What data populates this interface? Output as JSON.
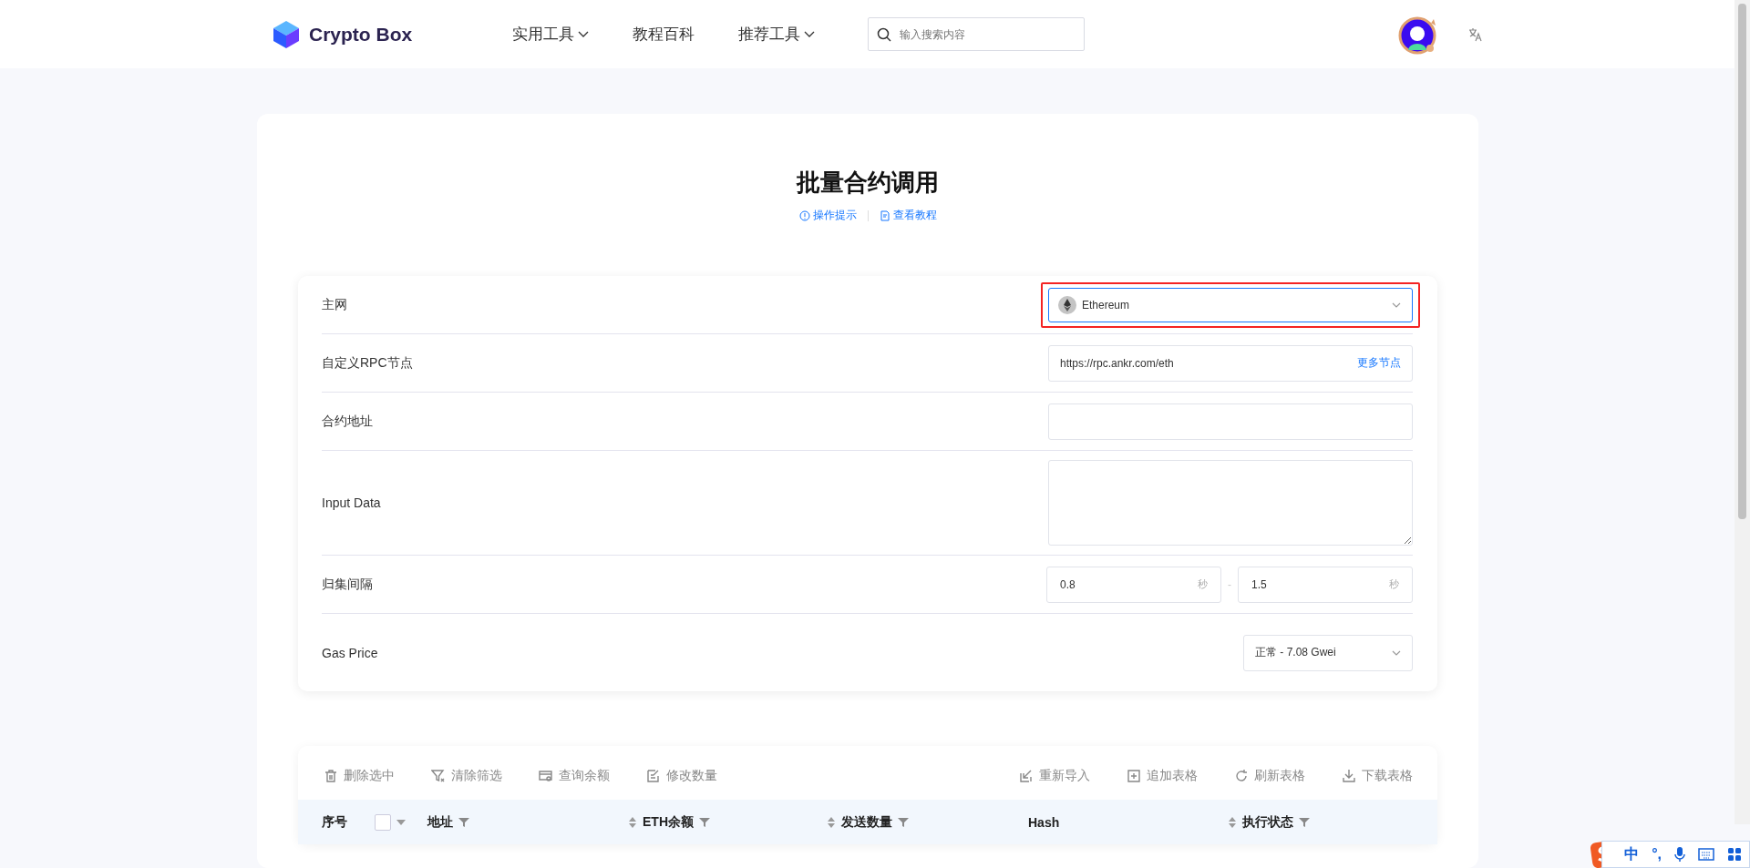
{
  "header": {
    "logo": "Crypto Box",
    "nav": [
      {
        "label": "实用工具",
        "dropdown": true
      },
      {
        "label": "教程百科",
        "dropdown": false
      },
      {
        "label": "推荐工具",
        "dropdown": true
      }
    ],
    "search": {
      "placeholder": "输入搜索内容"
    }
  },
  "page": {
    "title": "批量合约调用",
    "links": [
      {
        "kind": "info",
        "label": "操作提示"
      },
      {
        "kind": "doc",
        "label": "查看教程"
      }
    ]
  },
  "form": {
    "rows": [
      {
        "kind": "select",
        "label": "主网",
        "value": "Ethereum",
        "highlighted": true
      },
      {
        "kind": "input-link",
        "label": "自定义RPC节点",
        "value": "https://rpc.ankr.com/eth",
        "link": "更多节点"
      },
      {
        "kind": "input",
        "label": "合约地址"
      },
      {
        "kind": "textarea",
        "label": "Input Data"
      },
      {
        "kind": "range",
        "label": "归集间隔",
        "from": {
          "value": "0.8",
          "unit": "秒"
        },
        "separator": "-",
        "to": {
          "value": "1.5",
          "unit": "秒"
        }
      },
      {
        "kind": "gas",
        "label": "Gas Price",
        "value": "正常 - 7.08 Gwei"
      }
    ]
  },
  "table": {
    "toolbar_left": [
      {
        "kind": "trash",
        "label": "删除选中"
      },
      {
        "kind": "filter-clear",
        "label": "清除筛选"
      },
      {
        "kind": "card-search",
        "label": "查询余额"
      },
      {
        "kind": "edit",
        "label": "修改数量"
      }
    ],
    "toolbar_right": [
      {
        "kind": "import",
        "label": "重新导入"
      },
      {
        "kind": "add",
        "label": "追加表格"
      },
      {
        "kind": "refresh",
        "label": "刷新表格"
      },
      {
        "kind": "download",
        "label": "下载表格"
      }
    ],
    "select_all": {
      "checked": false
    },
    "columns": [
      {
        "kind": "index",
        "label": "序号"
      },
      {
        "kind": "filter",
        "label": "地址"
      },
      {
        "kind": "sort-filter",
        "label": "ETH余额"
      },
      {
        "kind": "sort-filter",
        "label": "发送数量"
      },
      {
        "kind": "plain",
        "label": "Hash"
      },
      {
        "kind": "sort-filter",
        "label": "执行状态"
      }
    ]
  },
  "ime_bar": {
    "mode": "中",
    "punctuation": "°,"
  }
}
